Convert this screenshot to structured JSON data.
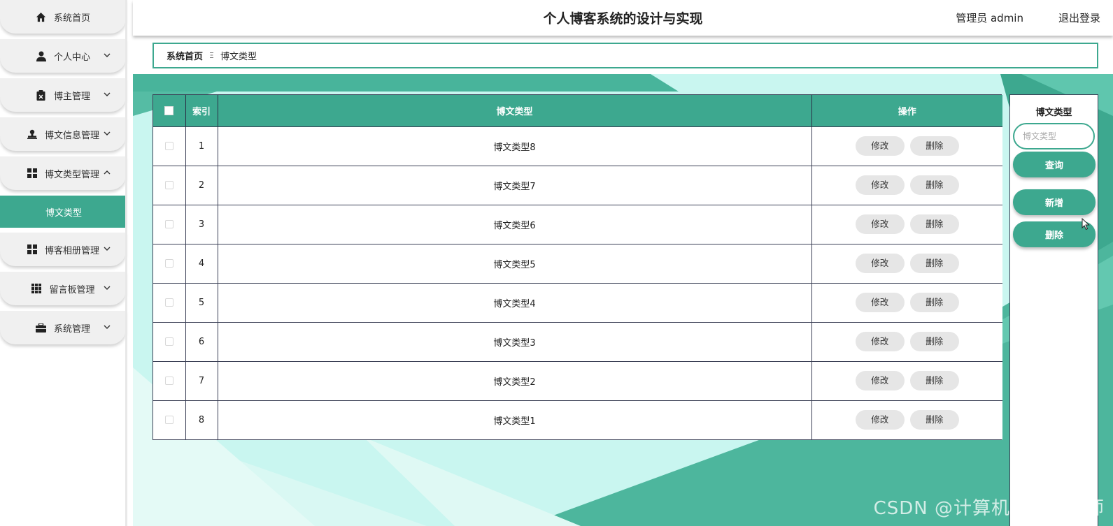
{
  "header": {
    "title": "个人博客系统的设计与实现",
    "admin_label": "管理员 admin",
    "logout_label": "退出登录"
  },
  "sidebar": {
    "items": [
      {
        "label": "系统首页",
        "icon": "home-icon"
      },
      {
        "label": "个人中心",
        "icon": "user-icon"
      },
      {
        "label": "博主管理",
        "icon": "clipboard-icon"
      },
      {
        "label": "博文信息管理",
        "icon": "stamp-icon"
      },
      {
        "label": "博文类型管理",
        "icon": "grid-icon"
      },
      {
        "label": "博客相册管理",
        "icon": "grid-icon"
      },
      {
        "label": "留言板管理",
        "icon": "apps-icon"
      },
      {
        "label": "系统管理",
        "icon": "briefcase-icon"
      }
    ],
    "active_submenu": "博文类型"
  },
  "breadcrumb": {
    "home": "系统首页",
    "separator": "Ξ",
    "current": "博文类型"
  },
  "table": {
    "headers": {
      "index": "索引",
      "type": "博文类型",
      "actions": "操作"
    },
    "edit_label": "修改",
    "delete_label": "删除",
    "rows": [
      {
        "index": "1",
        "type": "博文类型8"
      },
      {
        "index": "2",
        "type": "博文类型7"
      },
      {
        "index": "3",
        "type": "博文类型6"
      },
      {
        "index": "4",
        "type": "博文类型5"
      },
      {
        "index": "5",
        "type": "博文类型4"
      },
      {
        "index": "6",
        "type": "博文类型3"
      },
      {
        "index": "7",
        "type": "博文类型2"
      },
      {
        "index": "8",
        "type": "博文类型1"
      }
    ]
  },
  "panel": {
    "title": "博文类型",
    "search_placeholder": "博文类型",
    "query_label": "查询",
    "add_label": "新增",
    "delete_label": "删除"
  },
  "watermark": "CSDN @计算机编程指导师",
  "colors": {
    "accent": "#3da88f",
    "background_light": "#c8f5ef"
  }
}
